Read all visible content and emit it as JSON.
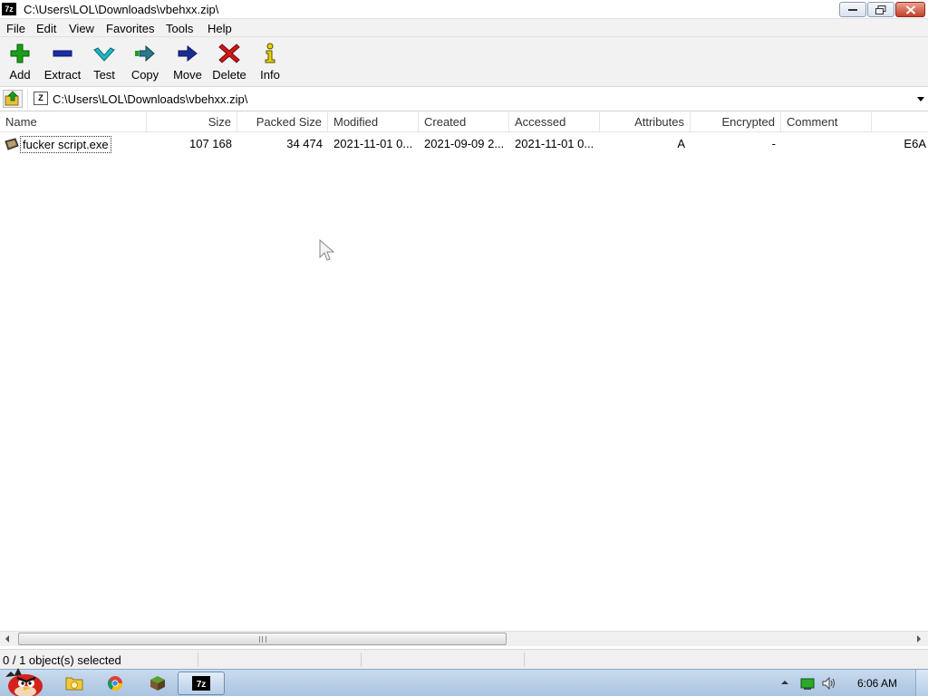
{
  "window": {
    "title": "C:\\Users\\LOL\\Downloads\\vbehxx.zip\\",
    "app_icon_text": "7z"
  },
  "menu": [
    "File",
    "Edit",
    "View",
    "Favorites",
    "Tools",
    "Help"
  ],
  "toolbar": {
    "add": "Add",
    "extract": "Extract",
    "test": "Test",
    "copy": "Copy",
    "move": "Move",
    "delete": "Delete",
    "info": "Info"
  },
  "address": {
    "path": "C:\\Users\\LOL\\Downloads\\vbehxx.zip\\"
  },
  "columns": {
    "name": "Name",
    "size": "Size",
    "packed": "Packed Size",
    "modified": "Modified",
    "created": "Created",
    "accessed": "Accessed",
    "attributes": "Attributes",
    "encrypted": "Encrypted",
    "comment": "Comment"
  },
  "rows": [
    {
      "name": "fucker script.exe",
      "size": "107 168",
      "packed": "34 474",
      "modified": "2021-11-01 0...",
      "created": "2021-09-09 2...",
      "accessed": "2021-11-01 0...",
      "attributes": "A",
      "encrypted": "-",
      "comment": "",
      "crc": "E6A"
    }
  ],
  "status": {
    "selection": "0 / 1 object(s) selected"
  },
  "taskbar": {
    "clock": "6:06 AM",
    "taskbar_color": "#b9cfe8"
  },
  "colors": {
    "add_icon": "#1aa01a",
    "extract_icon": "#1a2ea8",
    "test_icon": "#1fb8c8",
    "delete_icon": "#d01818",
    "info_icon": "#b8a000"
  }
}
